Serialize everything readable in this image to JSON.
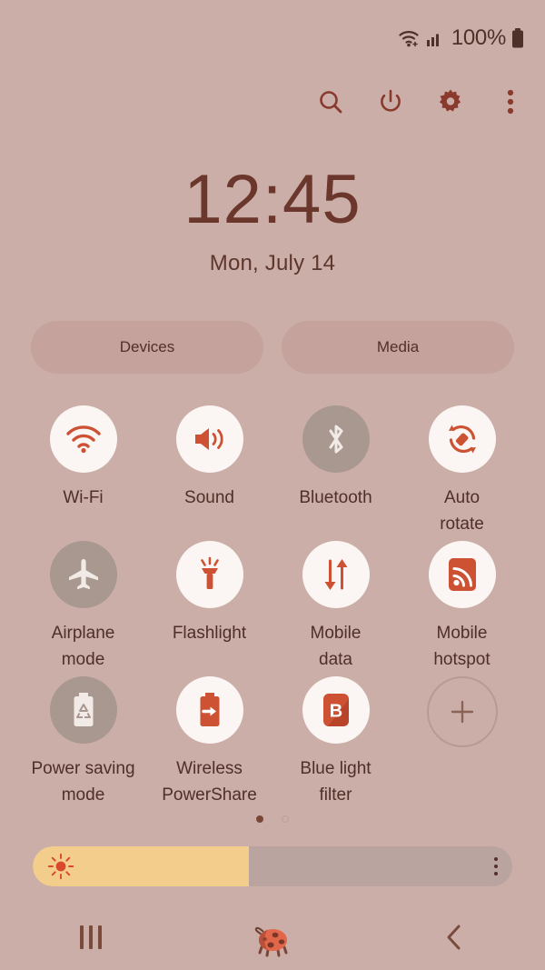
{
  "status_bar": {
    "wifi_icon": "wifi-icon",
    "signal_icon": "cellular-signal-icon",
    "battery_text": "100%",
    "battery_icon": "battery-full-icon"
  },
  "toolbar": {
    "items": [
      {
        "name": "search-icon",
        "label": "Search"
      },
      {
        "name": "power-icon",
        "label": "Power"
      },
      {
        "name": "gear-icon",
        "label": "Settings"
      },
      {
        "name": "more-options-icon",
        "label": "More options"
      }
    ]
  },
  "clock": {
    "time": "12:45",
    "date": "Mon, July 14"
  },
  "pills": [
    {
      "label": "Devices"
    },
    {
      "label": "Media"
    }
  ],
  "tiles": [
    {
      "label": "Wi-Fi",
      "icon": "wifi-icon",
      "state": "on"
    },
    {
      "label": "Sound",
      "icon": "sound-icon",
      "state": "on"
    },
    {
      "label": "Bluetooth",
      "icon": "bluetooth-icon",
      "state": "off"
    },
    {
      "label": "Auto\nrotate",
      "icon": "auto-rotate-icon",
      "state": "on"
    },
    {
      "label": "Airplane\nmode",
      "icon": "airplane-icon",
      "state": "off"
    },
    {
      "label": "Flashlight",
      "icon": "flashlight-icon",
      "state": "on"
    },
    {
      "label": "Mobile\ndata",
      "icon": "mobile-data-icon",
      "state": "on"
    },
    {
      "label": "Mobile\nhotspot",
      "icon": "mobile-hotspot-icon",
      "state": "on"
    },
    {
      "label": "Power saving\nmode",
      "icon": "power-saving-icon",
      "state": "off"
    },
    {
      "label": "Wireless\nPowerShare",
      "icon": "power-share-icon",
      "state": "on"
    },
    {
      "label": "Blue light\nfilter",
      "icon": "blue-light-filter-icon",
      "state": "on"
    },
    {
      "label": "",
      "icon": "add-icon",
      "state": "add"
    }
  ],
  "pagination": {
    "total_pages": 2,
    "current_page": 1
  },
  "brightness": {
    "value_percent": 45,
    "sun_icon": "brightness-sun-icon",
    "menu_icon": "brightness-options-icon"
  },
  "nav_bar": {
    "recents": "recents-icon",
    "home": "home-ladybug-icon",
    "back": "back-icon"
  },
  "colors": {
    "background": "#cbaea8",
    "accent": "#cc5233",
    "tile_on_bg": "#fbf6f3",
    "tile_off_bg": "#a8988f",
    "text": "#4f2f28",
    "brightness_fill": "#f3cd8c"
  }
}
